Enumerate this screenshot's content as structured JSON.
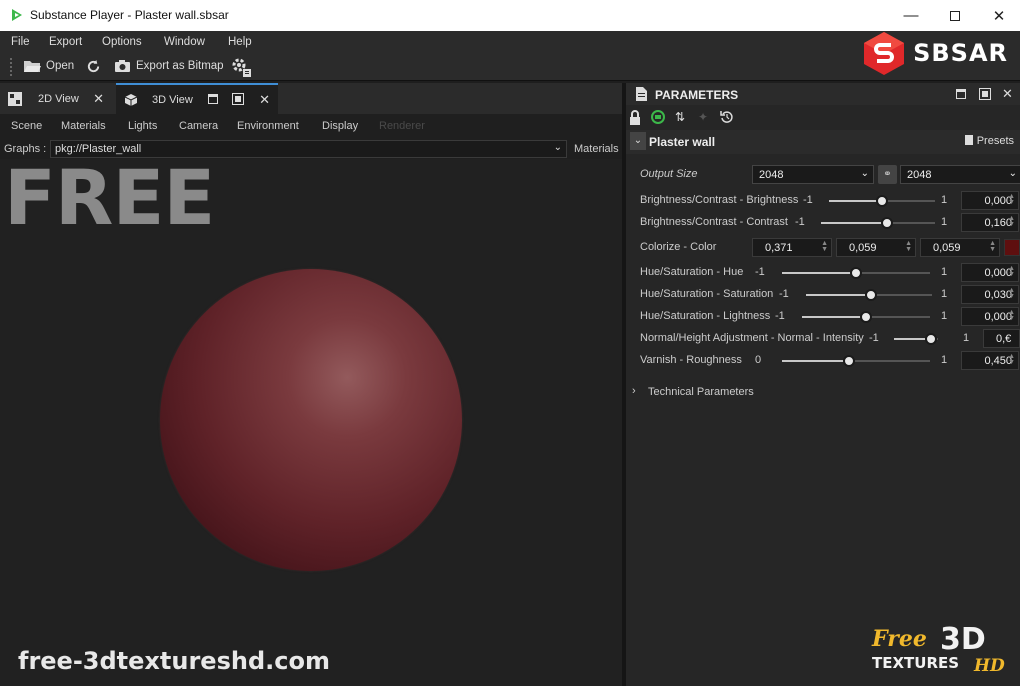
{
  "window": {
    "title": "Substance Player - Plaster wall.sbsar"
  },
  "menu": [
    "File",
    "Export",
    "Options",
    "Window",
    "Help"
  ],
  "toolbar": {
    "open": "Open",
    "export": "Export as Bitmap"
  },
  "brand": {
    "sbsar": "SBSAR",
    "accent": "#e0282a"
  },
  "tabs": {
    "view2d": "2D View",
    "view3d": "3D View"
  },
  "subtabs": [
    "Scene",
    "Materials",
    "Lights",
    "Camera",
    "Environment",
    "Display",
    "Renderer"
  ],
  "graphs": {
    "label": "Graphs :",
    "value": "pkg://Plaster_wall",
    "materials": "Materials"
  },
  "viewport": {
    "watermark": "FREE",
    "site": "free-3dtextureshd.com"
  },
  "parameters": {
    "title": "PARAMETERS",
    "graph_name": "Plaster wall",
    "presets": "Presets",
    "output_size": {
      "label": "Output Size",
      "w": "2048",
      "h": "2048"
    },
    "colorize": {
      "label": "Colorize - Color",
      "r": "0,371",
      "g": "0,059",
      "b": "0,059",
      "swatch": "#5e0f0f"
    },
    "sliders": [
      {
        "label": "Brightness/Contrast - Brightness",
        "min": "-1",
        "max": "1",
        "value": "0,000",
        "fraction": 0.5
      },
      {
        "label": "Brightness/Contrast - Contrast",
        "min": "-1",
        "max": "1",
        "value": "0,160",
        "fraction": 0.58
      },
      {
        "label": "Hue/Saturation - Hue",
        "min": "-1",
        "max": "1",
        "value": "0,000",
        "fraction": 0.5
      },
      {
        "label": "Hue/Saturation - Saturation",
        "min": "-1",
        "max": "1",
        "value": "0,030",
        "fraction": 0.515
      },
      {
        "label": "Hue/Saturation - Lightness",
        "min": "-1",
        "max": "1",
        "value": "0,000",
        "fraction": 0.5
      },
      {
        "label": "Normal/Height Adjustment - Normal - Intensity",
        "min": "-1",
        "max": "1",
        "value": "0,€",
        "fraction": 0.85
      },
      {
        "label": "Varnish - Roughness",
        "min": "0",
        "max": "1",
        "value": "0,450",
        "fraction": 0.45
      }
    ],
    "technical": "Technical Parameters"
  },
  "logo_free3d": {
    "free": "Free",
    "three_d": "3D",
    "textures": "TEXTURES",
    "hd": "HD"
  }
}
